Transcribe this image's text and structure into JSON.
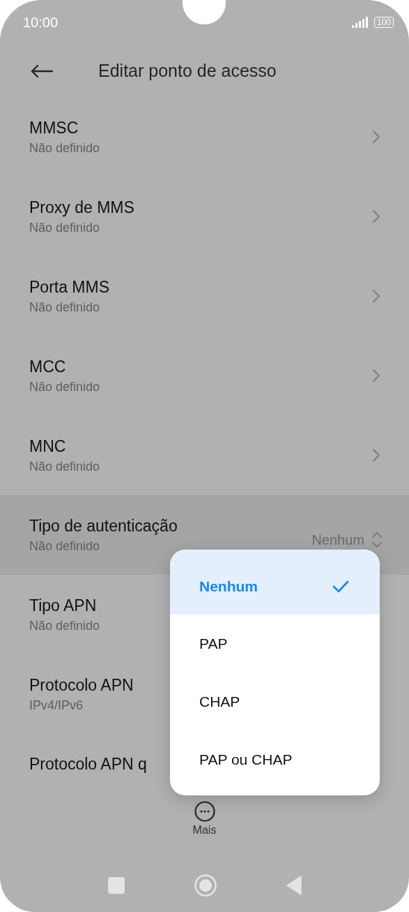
{
  "status_bar": {
    "time": "10:00",
    "battery": "100"
  },
  "header": {
    "title": "Editar ponto de acesso"
  },
  "settings": [
    {
      "title": "MMSC",
      "subtitle": "Não definido",
      "kind": "link",
      "highlighted": false
    },
    {
      "title": "Proxy de MMS",
      "subtitle": "Não definido",
      "kind": "link",
      "highlighted": false
    },
    {
      "title": "Porta MMS",
      "subtitle": "Não definido",
      "kind": "link",
      "highlighted": false
    },
    {
      "title": "MCC",
      "subtitle": "Não definido",
      "kind": "link",
      "highlighted": false
    },
    {
      "title": "MNC",
      "subtitle": "Não definido",
      "kind": "link",
      "highlighted": false
    },
    {
      "title": "Tipo de autenticação",
      "subtitle": "Não definido",
      "kind": "select",
      "value": "Nenhum",
      "highlighted": true
    },
    {
      "title": "Tipo APN",
      "subtitle": "Não definido",
      "kind": "plain",
      "highlighted": false
    },
    {
      "title": "Protocolo APN",
      "subtitle": "IPv4/IPv6",
      "kind": "plain",
      "highlighted": false
    },
    {
      "title": "Protocolo APN q",
      "kind": "plain",
      "highlighted": false
    }
  ],
  "dropdown": {
    "options": [
      {
        "label": "Nenhum",
        "selected": true
      },
      {
        "label": "PAP",
        "selected": false
      },
      {
        "label": "CHAP",
        "selected": false
      },
      {
        "label": "PAP ou CHAP",
        "selected": false
      }
    ]
  },
  "bottom_action": {
    "label": "Mais"
  }
}
